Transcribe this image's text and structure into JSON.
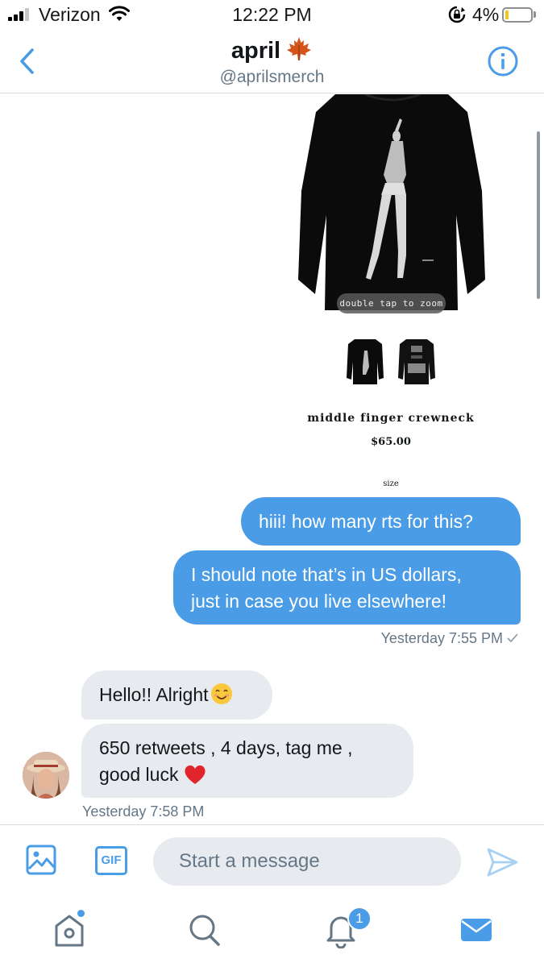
{
  "status_bar": {
    "carrier": "Verizon",
    "time": "12:22 PM",
    "battery_percent": "4%",
    "battery_level": 0.04,
    "icons": [
      "signal-icon",
      "wifi-icon",
      "rotation-lock-icon",
      "battery-icon"
    ]
  },
  "header": {
    "name": "april",
    "name_emoji": "maple-leaf-icon",
    "handle": "@aprilsmerch",
    "back_icon": "chevron-left-icon",
    "info_icon": "info-icon"
  },
  "shared_product": {
    "zoom_hint": "double tap to zoom",
    "name": "middle finger crewneck",
    "price": "$65.00",
    "size_label": "size"
  },
  "messages": [
    {
      "direction": "outgoing",
      "lines": [
        "hiii! how many rts for this?"
      ]
    },
    {
      "direction": "outgoing",
      "lines": [
        "I should note that’s in US dollars,",
        "just in case you live elsewhere!"
      ]
    },
    {
      "direction": "incoming",
      "lines": [
        "Hello!! Alright"
      ],
      "emoji": "smiling-face-icon"
    },
    {
      "direction": "incoming",
      "lines": [
        "650 retweets , 4 days, tag me ,",
        "good luck"
      ],
      "emoji": "red-heart-icon"
    }
  ],
  "outgoing_timestamp": "Yesterday 7:55 PM",
  "incoming_timestamp": "Yesterday 7:58 PM",
  "composer": {
    "placeholder": "Start a message",
    "gif_label": "GIF",
    "media_icon": "image-icon",
    "send_icon": "send-icon"
  },
  "tabs": [
    {
      "name": "home",
      "icon": "home-icon",
      "has_dot": true
    },
    {
      "name": "search",
      "icon": "search-icon"
    },
    {
      "name": "notifications",
      "icon": "bell-icon",
      "badge": "1"
    },
    {
      "name": "messages",
      "icon": "mail-icon",
      "active": true
    }
  ],
  "colors": {
    "accent": "#4a9ce6",
    "incoming_bubble": "#e7ebef",
    "secondary_text": "#657786"
  }
}
